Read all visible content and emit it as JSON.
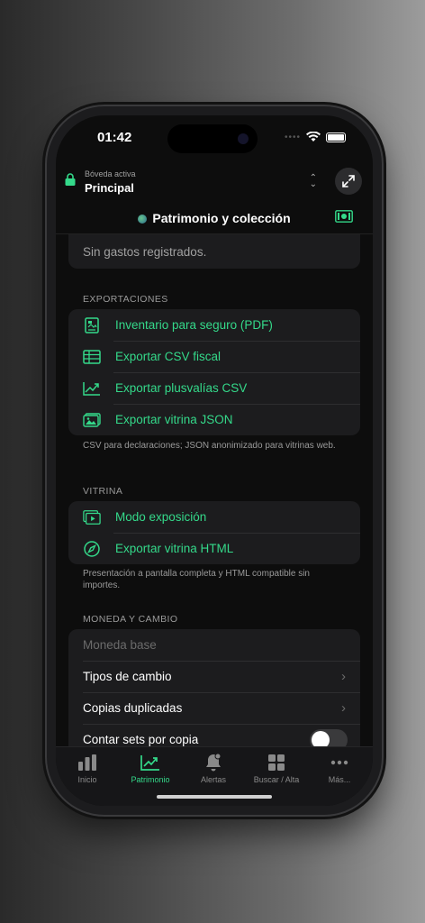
{
  "status": {
    "time": "01:42"
  },
  "vault": {
    "label": "Bóveda activa",
    "name": "Principal"
  },
  "nav": {
    "title": "Patrimonio y colección"
  },
  "expenses": {
    "empty": "Sin gastos registrados."
  },
  "exports": {
    "header": "EXPORTACIONES",
    "items": [
      {
        "label": "Inventario para seguro (PDF)",
        "icon": "document-icon"
      },
      {
        "label": "Exportar CSV fiscal",
        "icon": "table-icon"
      },
      {
        "label": "Exportar plusvalías CSV",
        "icon": "chart-icon"
      },
      {
        "label": "Exportar vitrina JSON",
        "icon": "photos-icon"
      }
    ],
    "footnote": "CSV para declaraciones; JSON anonimizado para vitrinas web."
  },
  "showcase": {
    "header": "VITRINA",
    "items": [
      {
        "label": "Modo exposición",
        "icon": "play-icon"
      },
      {
        "label": "Exportar vitrina HTML",
        "icon": "compass-icon"
      }
    ],
    "footnote": "Presentación a pantalla completa y HTML compatible sin importes."
  },
  "currency": {
    "header": "MONEDA Y CAMBIO",
    "base_placeholder": "Moneda base",
    "rates": "Tipos de cambio",
    "duplicates": "Copias duplicadas",
    "count_sets": "Contar sets por copia",
    "count_sets_on": false
  },
  "tabs": [
    {
      "label": "Inicio"
    },
    {
      "label": "Patrimonio"
    },
    {
      "label": "Alertas"
    },
    {
      "label": "Buscar / Alta"
    },
    {
      "label": "Más..."
    }
  ],
  "colors": {
    "accent": "#34d98a",
    "background": "#0d0d0d",
    "group": "#1c1c1e"
  }
}
